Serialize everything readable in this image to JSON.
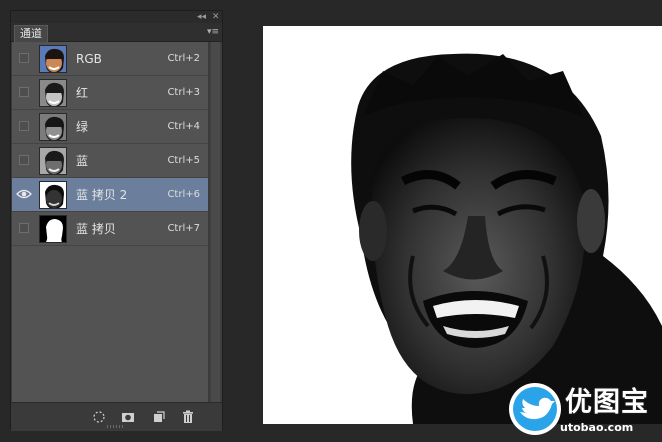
{
  "panel": {
    "tab_label": "通道",
    "collapse_glyph": "◂◂",
    "close_glyph": "✕",
    "menu_glyph": "▾≡"
  },
  "channels": [
    {
      "name": "RGB",
      "shortcut": "Ctrl+2",
      "visible": false,
      "selected": false
    },
    {
      "name": "红",
      "shortcut": "Ctrl+3",
      "visible": false,
      "selected": false
    },
    {
      "name": "绿",
      "shortcut": "Ctrl+4",
      "visible": false,
      "selected": false
    },
    {
      "name": "蓝",
      "shortcut": "Ctrl+5",
      "visible": false,
      "selected": false
    },
    {
      "name": "蓝 拷贝 2",
      "shortcut": "Ctrl+6",
      "visible": true,
      "selected": true
    },
    {
      "name": "蓝 拷贝",
      "shortcut": "Ctrl+7",
      "visible": false,
      "selected": false
    }
  ],
  "bottom_icons": [
    "selection-icon",
    "mask-icon",
    "new-channel-icon",
    "trash-icon"
  ],
  "watermark": {
    "brand": "优图宝",
    "site": "utobao.com"
  },
  "colors": {
    "panel_bg": "#535353",
    "selected_row": "#6b7f9c",
    "app_bg": "#282828",
    "watermark_blue": "#2aa3e8"
  }
}
